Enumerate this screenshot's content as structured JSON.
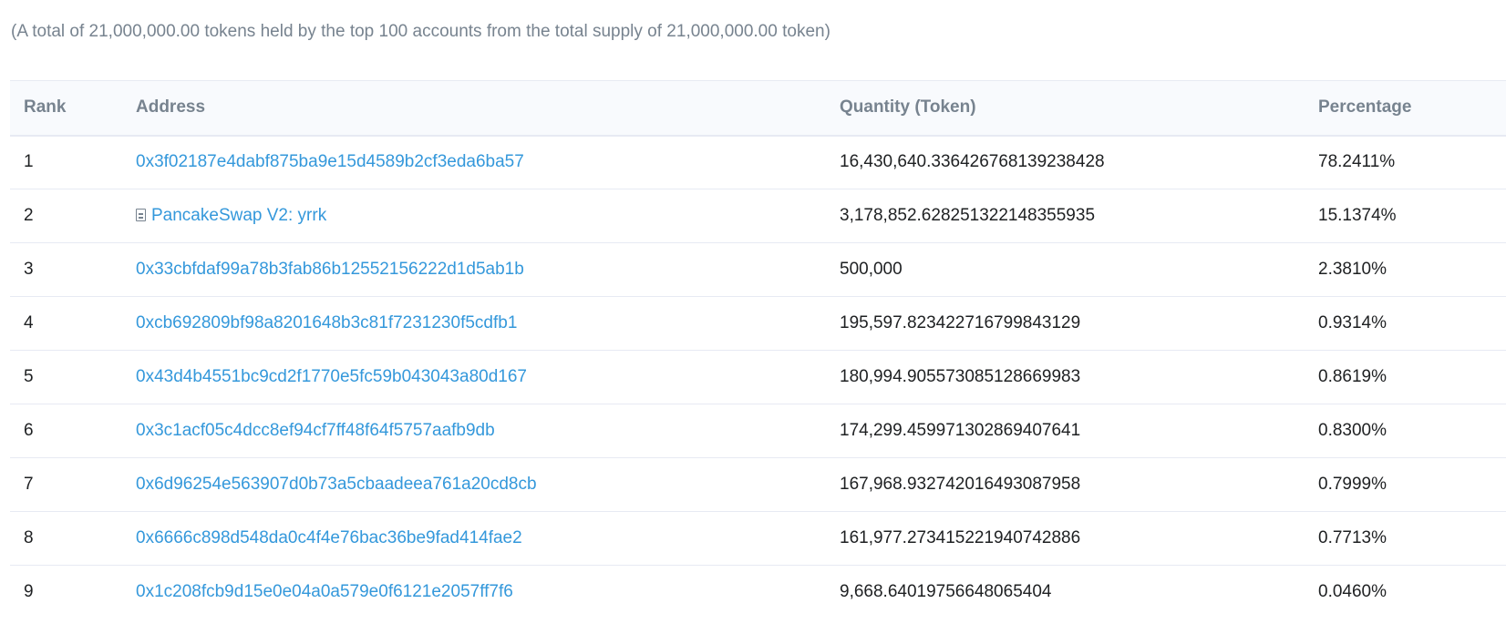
{
  "summary_text": "(A total of 21,000,000.00 tokens held by the top 100 accounts from the total supply of 21,000,000.00 token)",
  "table": {
    "headers": {
      "rank": "Rank",
      "address": "Address",
      "quantity": "Quantity (Token)",
      "percentage": "Percentage"
    },
    "rows": [
      {
        "rank": "1",
        "address": "0x3f02187e4dabf875ba9e15d4589b2cf3eda6ba57",
        "quantity": "16,430,640.336426768139238428",
        "percentage": "78.2411%"
      },
      {
        "rank": "2",
        "address": "PancakeSwap V2: yrrk",
        "quantity": "3,178,852.628251322148355935",
        "percentage": "15.1374%",
        "icon": "contract-file-icon"
      },
      {
        "rank": "3",
        "address": "0x33cbfdaf99a78b3fab86b12552156222d1d5ab1b",
        "quantity": "500,000",
        "percentage": "2.3810%"
      },
      {
        "rank": "4",
        "address": "0xcb692809bf98a8201648b3c81f7231230f5cdfb1",
        "quantity": "195,597.823422716799843129",
        "percentage": "0.9314%"
      },
      {
        "rank": "5",
        "address": "0x43d4b4551bc9cd2f1770e5fc59b043043a80d167",
        "quantity": "180,994.905573085128669983",
        "percentage": "0.8619%"
      },
      {
        "rank": "6",
        "address": "0x3c1acf05c4dcc8ef94cf7ff48f64f5757aafb9db",
        "quantity": "174,299.459971302869407641",
        "percentage": "0.8300%"
      },
      {
        "rank": "7",
        "address": "0x6d96254e563907d0b73a5cbaadeea761a20cd8cb",
        "quantity": "167,968.932742016493087958",
        "percentage": "0.7999%"
      },
      {
        "rank": "8",
        "address": "0x6666c898d548da0c4f4e76bac36be9fad414fae2",
        "quantity": "161,977.273415221940742886",
        "percentage": "0.7713%"
      },
      {
        "rank": "9",
        "address": "0x1c208fcb9d15e0e04a0a579e0f6121e2057ff7f6",
        "quantity": "9,668.64019756648065404",
        "percentage": "0.0460%"
      }
    ]
  },
  "colors": {
    "link": "#3498db",
    "muted": "#77838f",
    "header_bg": "#f8fafd",
    "border": "#e7eaf3"
  }
}
